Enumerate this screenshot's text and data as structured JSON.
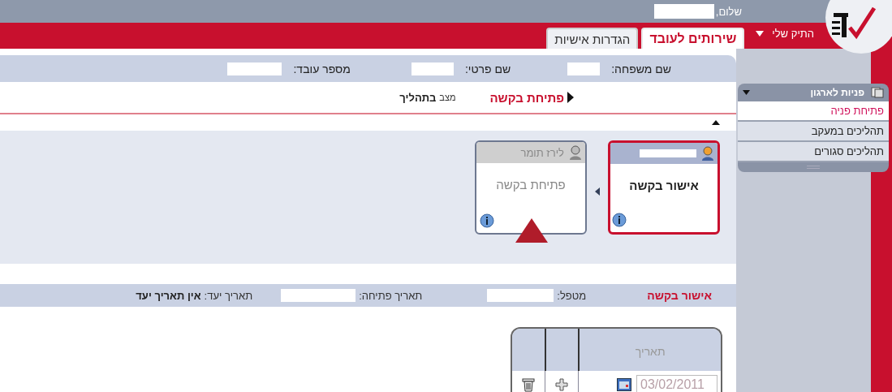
{
  "greeting": {
    "label": "שלום,"
  },
  "top_menu": {
    "label": "התיק שלי"
  },
  "tabs": [
    {
      "label": "שירותים לעובד",
      "selected": true
    },
    {
      "label": "הגדרות אישיות",
      "selected": false
    }
  ],
  "employee_fields": [
    {
      "label": "שם משפחה:"
    },
    {
      "label": "שם פרטי:"
    },
    {
      "label": "מספר עובד:"
    }
  ],
  "request": {
    "title": "פתיחת בקשה",
    "status_label": "מצב",
    "status": "בתהליך"
  },
  "steps": [
    {
      "title": "אישור בקשה",
      "selected": true,
      "current": false
    },
    {
      "title": "פתיחת בקשה",
      "owner": "לירז תומר",
      "selected": false,
      "current": true
    }
  ],
  "step_details": {
    "step": "אישור בקשה",
    "handler_label": "מטפל:",
    "opened_label": "תאריך פתיחה:",
    "due_label": "תאריך יעד:",
    "due": "אין תאריך יעד"
  },
  "table": {
    "columns": [
      "תאריך"
    ],
    "rows": [
      {
        "date": "03/02/2011"
      }
    ]
  },
  "sidebar": {
    "title": "פניות לארגון",
    "items": [
      {
        "label": "פתיחת פניה",
        "selected": true
      },
      {
        "label": "תהליכים במעקב",
        "selected": false
      },
      {
        "label": "תהליכים סגורים",
        "selected": false
      }
    ]
  }
}
